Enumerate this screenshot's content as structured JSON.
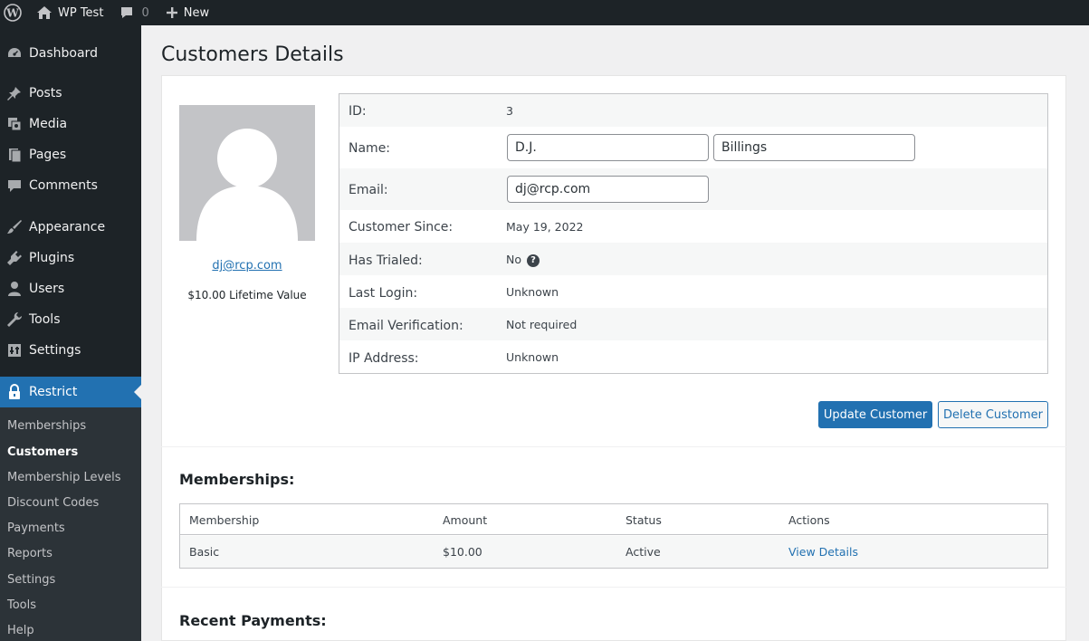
{
  "adminbar": {
    "site_name": "WP Test",
    "comments_count": "0",
    "new_label": "New"
  },
  "sidebar": {
    "items": [
      {
        "label": "Dashboard",
        "icon": "dashboard-icon"
      },
      {
        "label": "Posts",
        "icon": "pin-icon"
      },
      {
        "label": "Media",
        "icon": "media-icon"
      },
      {
        "label": "Pages",
        "icon": "pages-icon"
      },
      {
        "label": "Comments",
        "icon": "comments-icon"
      },
      {
        "label": "Appearance",
        "icon": "brush-icon"
      },
      {
        "label": "Plugins",
        "icon": "plugin-icon"
      },
      {
        "label": "Users",
        "icon": "user-icon"
      },
      {
        "label": "Tools",
        "icon": "wrench-icon"
      },
      {
        "label": "Settings",
        "icon": "settings-icon"
      },
      {
        "label": "Restrict",
        "icon": "lock-icon"
      }
    ],
    "submenu": [
      "Memberships",
      "Customers",
      "Membership Levels",
      "Discount Codes",
      "Payments",
      "Reports",
      "Settings",
      "Tools",
      "Help"
    ]
  },
  "page": {
    "title": "Customers Details"
  },
  "customer": {
    "avatar_email": "dj@rcp.com",
    "lifetime_value": "$10.00 Lifetime Value",
    "fields": {
      "id_label": "ID:",
      "id_value": "3",
      "name_label": "Name:",
      "first_name": "D.J.",
      "last_name": "Billings",
      "email_label": "Email:",
      "email_value": "dj@rcp.com",
      "since_label": "Customer Since:",
      "since_value": "May 19, 2022",
      "trialed_label": "Has Trialed:",
      "trialed_value": "No",
      "login_label": "Last Login:",
      "login_value": "Unknown",
      "verification_label": "Email Verification:",
      "verification_value": "Not required",
      "ip_label": "IP Address:",
      "ip_value": "Unknown"
    },
    "update_button": "Update Customer",
    "delete_button": "Delete Customer"
  },
  "memberships": {
    "heading": "Memberships:",
    "columns": [
      "Membership",
      "Amount",
      "Status",
      "Actions"
    ],
    "rows": [
      {
        "membership": "Basic",
        "amount": "$10.00",
        "status": "Active",
        "action": "View Details"
      }
    ]
  },
  "payments": {
    "heading": "Recent Payments:"
  },
  "colors": {
    "accent": "#2271b1",
    "admin_bg": "#1d2327"
  }
}
